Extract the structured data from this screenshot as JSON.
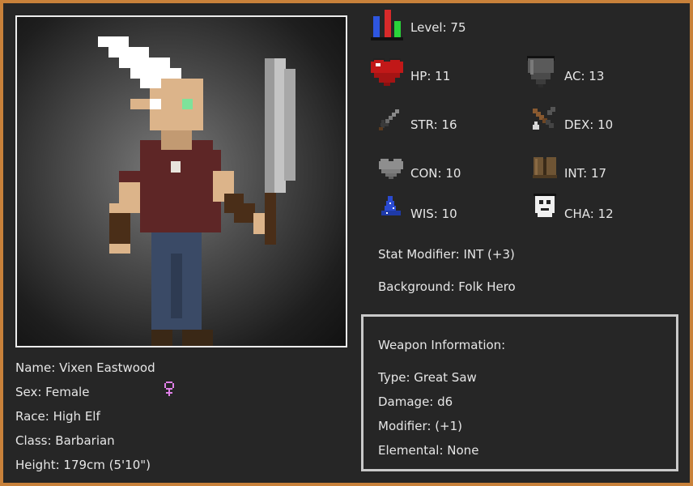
{
  "character": {
    "name": "Name: Vixen Eastwood",
    "sex": "Sex: Female",
    "race": "Race: High Elf",
    "class": "Class: Barbarian",
    "height": "Height: 179cm (5'10\")"
  },
  "stats": {
    "level": "Level: 75",
    "hp": "HP: 11",
    "ac": "AC: 13",
    "str": "STR: 16",
    "dex": "DEX: 10",
    "con": "CON: 10",
    "int": "INT: 17",
    "wis": "WIS: 10",
    "cha": "CHA: 12"
  },
  "details": {
    "stat_modifier": "Stat Modifier: INT (+3)",
    "background": "Background: Folk Hero"
  },
  "weapon": {
    "heading": "Weapon Information:",
    "type": "Type: Great Saw",
    "damage": "Damage: d6",
    "modifier": "Modifier: (+1)",
    "elemental": "Elemental: None"
  },
  "icons": {
    "level": "level-bars-icon",
    "hp": "heart-icon",
    "ac": "shield-icon",
    "str": "sword-icon",
    "dex": "crossbow-icon",
    "con": "grey-heart-icon",
    "int": "book-icon",
    "wis": "wizard-hat-icon",
    "cha": "mask-icon",
    "sex": "female-symbol-icon"
  },
  "colors": {
    "frame_border": "#c8813a",
    "panel_background": "#262626",
    "text": "#e6e6e6",
    "female_symbol": "#e080e8"
  }
}
